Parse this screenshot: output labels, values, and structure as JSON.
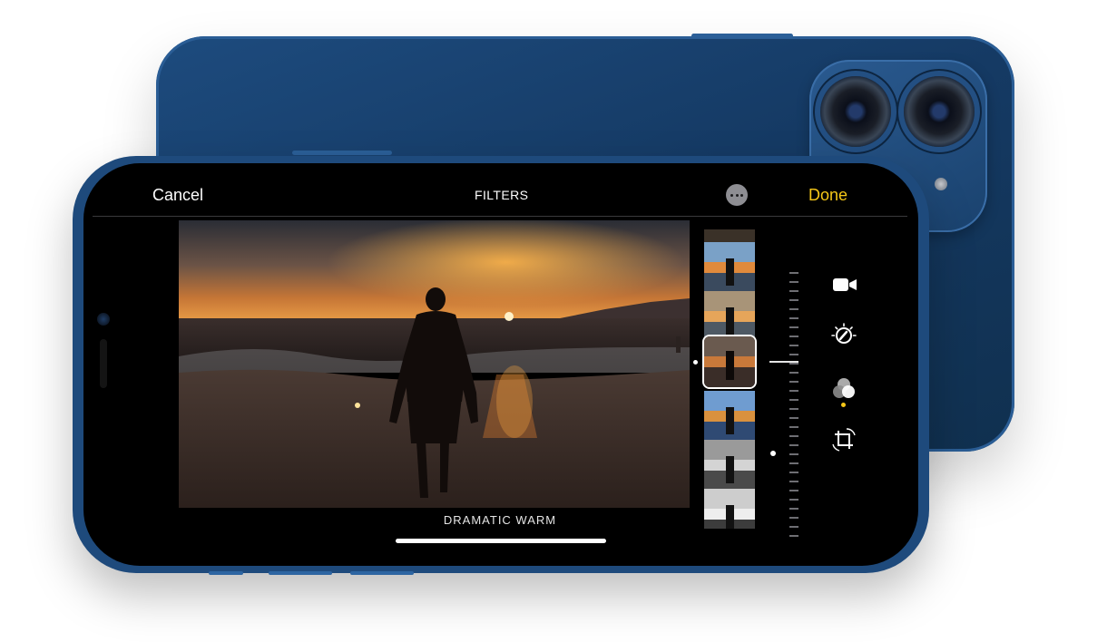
{
  "editor": {
    "cancel_label": "Cancel",
    "title": "FILTERS",
    "done_label": "Done",
    "selected_filter": "DRAMATIC WARM",
    "accent_color": "#f5c718"
  },
  "icons": {
    "more": "more-options-icon",
    "video": "video-camera-icon",
    "adjust": "adjust-dial-icon",
    "filters": "filters-icon",
    "crop": "crop-rotate-icon"
  },
  "filters_strip": {
    "items": [
      "filter-thumb",
      "filter-thumb",
      "filter-thumb",
      "filter-thumb",
      "filter-thumb",
      "filter-thumb"
    ],
    "selected_index": 2
  }
}
